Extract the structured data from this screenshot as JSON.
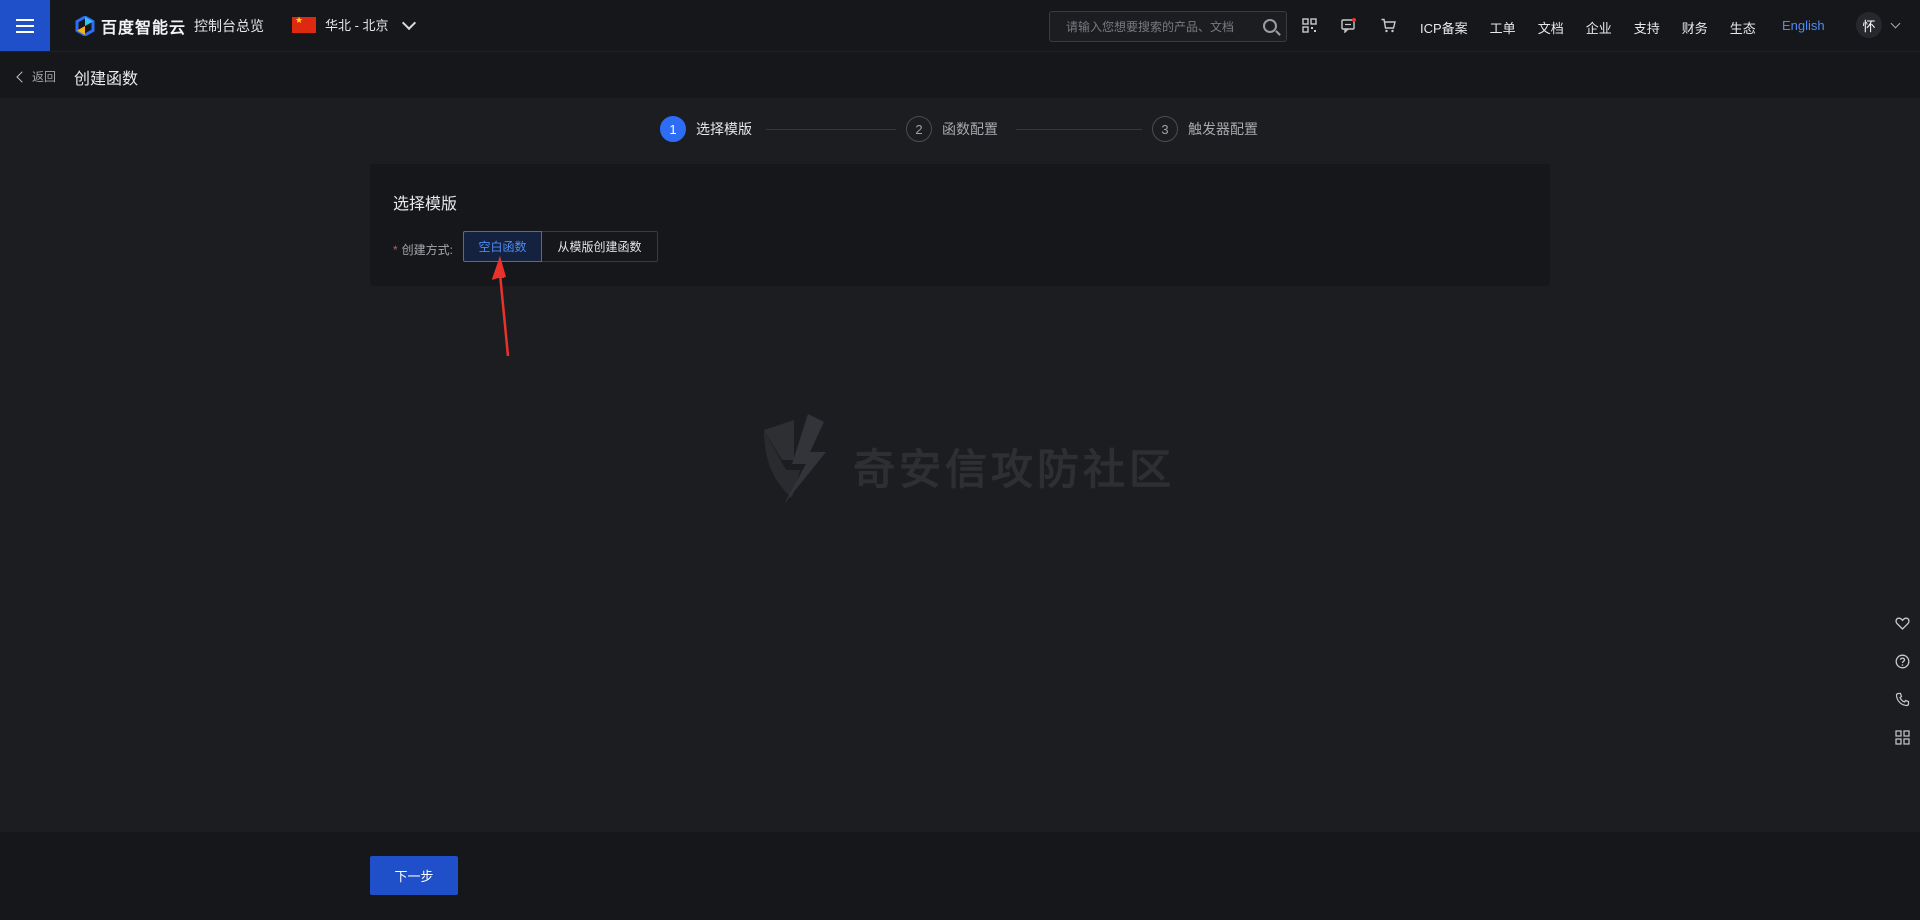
{
  "topbar": {
    "logo_text": "百度智能云",
    "console_label": "控制台总览",
    "region_label": "华北 - 北京",
    "search_placeholder": "请输入您想要搜索的产品、文档",
    "nav_links": [
      "ICP备案",
      "工单",
      "文档",
      "企业",
      "支持",
      "财务",
      "生态"
    ],
    "language_label": "English",
    "avatar_text": "怀",
    "icons": [
      "qrcode-icon",
      "message-icon",
      "cart-icon"
    ]
  },
  "subheader": {
    "back_label": "返回",
    "page_title": "创建函数"
  },
  "steps": [
    {
      "num": "1",
      "label": "选择模版",
      "active": true
    },
    {
      "num": "2",
      "label": "函数配置",
      "active": false
    },
    {
      "num": "3",
      "label": "触发器配置",
      "active": false
    }
  ],
  "card": {
    "title": "选择模版",
    "field_label": "创建方式:",
    "required_mark": "*",
    "options": [
      "空白函数",
      "从模版创建函数"
    ],
    "selected_option": "空白函数"
  },
  "watermark": {
    "text": "奇安信攻防社区"
  },
  "side_tools": [
    "favorite-icon",
    "help-icon",
    "phone-icon",
    "apps-icon"
  ],
  "footer": {
    "next_label": "下一步"
  },
  "colors": {
    "accent": "#2d6df6",
    "brand_button": "#1f4fc9",
    "annotation_arrow": "#e8322b"
  }
}
